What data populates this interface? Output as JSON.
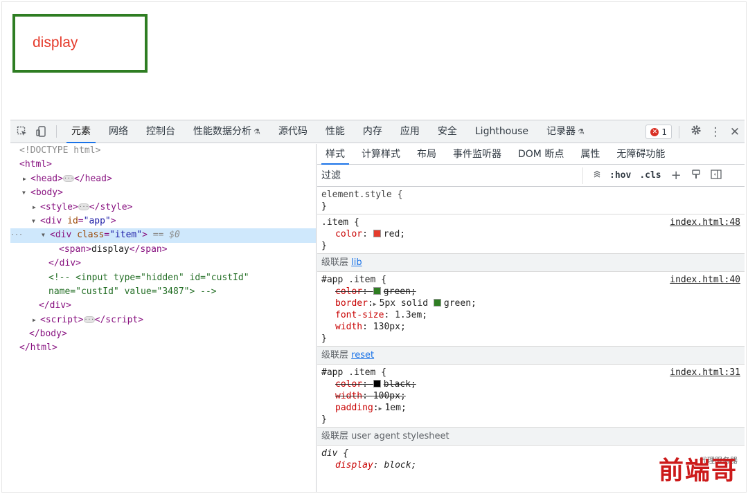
{
  "preview": {
    "text": "display",
    "border_color": "#2e7d22",
    "text_color": "#e53b2c"
  },
  "devtools": {
    "tabs": [
      {
        "label": "元素",
        "active": true
      },
      {
        "label": "网络"
      },
      {
        "label": "控制台"
      },
      {
        "label": "性能数据分析",
        "flask": true
      },
      {
        "label": "源代码"
      },
      {
        "label": "性能"
      },
      {
        "label": "内存"
      },
      {
        "label": "应用"
      },
      {
        "label": "安全"
      },
      {
        "label": "Lighthouse"
      },
      {
        "label": "记录器",
        "flask": true
      }
    ],
    "error_count": "1",
    "icons": [
      "inspect-icon",
      "device-toggle-icon",
      "flask-icon",
      "error-icon",
      "gear-icon",
      "more-icon",
      "close-icon"
    ]
  },
  "elements": {
    "lines": [
      {
        "indent": 0,
        "html": "doc",
        "text": "<!DOCTYPE html>"
      },
      {
        "indent": 0,
        "open": "html"
      },
      {
        "indent": 1,
        "tri": "right",
        "collapsed": "head"
      },
      {
        "indent": 1,
        "tri": "down",
        "open": "body"
      },
      {
        "indent": 2,
        "tri": "right",
        "collapsed": "style"
      },
      {
        "indent": 2,
        "tri": "down",
        "div_app": true
      },
      {
        "indent": 3,
        "tri": "down",
        "div_item": true,
        "selected": true
      },
      {
        "indent": 4,
        "span": true
      },
      {
        "indent": 3,
        "close": "div"
      },
      {
        "indent": 3,
        "comment1": true
      },
      {
        "indent": 3,
        "comment2": true
      },
      {
        "indent": 2,
        "close": "div"
      },
      {
        "indent": 2,
        "tri": "right",
        "collapsed": "script"
      },
      {
        "indent": 1,
        "close": "body"
      },
      {
        "indent": 0,
        "close": "html"
      }
    ],
    "strings": {
      "doctype": "<!DOCTYPE html>",
      "html": "html",
      "head": "head",
      "body": "body",
      "style": "style",
      "div": "div",
      "script": "script",
      "span": "span",
      "id_attr": "id",
      "app": "\"app\"",
      "class_attr": "class",
      "item": "\"item\"",
      "eq_ref": "== $0",
      "span_text": "display",
      "comment_line1": "<!-- <input type=\"hidden\" id=\"custId\"",
      "comment_line2": "name=\"custId\" value=\"3487\"> -->"
    }
  },
  "styles": {
    "subtabs": [
      "样式",
      "计算样式",
      "布局",
      "事件监听器",
      "DOM 断点",
      "属性",
      "无障碍功能"
    ],
    "filter_placeholder": "过滤",
    "hov": ":hov",
    "cls": ".cls",
    "element_style": "element.style {",
    "close_brace": "}",
    "rule_item": {
      "selector": ".item {",
      "source": "index.html:48",
      "props": [
        {
          "name": "color",
          "value": "red",
          "swatch": "#e53b2c"
        }
      ]
    },
    "layer_lib": {
      "prefix": "级联层",
      "link": "lib"
    },
    "rule_app_item_lib": {
      "selector": "#app .item {",
      "source": "index.html:40",
      "color_name": "color",
      "color_value": "green",
      "color_swatch": "#2e7d22",
      "border_name": "border",
      "border_value_a": "5px solid",
      "border_value_b": "green",
      "fontsize_name": "font-size",
      "fontsize_value": "1.3em",
      "width_name": "width",
      "width_value": "130px"
    },
    "layer_reset": {
      "prefix": "级联层",
      "link": "reset"
    },
    "rule_app_item_reset": {
      "selector": "#app .item {",
      "source": "index.html:31",
      "color_name": "color",
      "color_value": "black",
      "color_swatch": "#000000",
      "width_name": "width",
      "width_value": "100px",
      "padding_name": "padding",
      "padding_value": "1em"
    },
    "layer_ua": {
      "prefix": "级联层",
      "label": "user agent stylesheet"
    },
    "rule_div": {
      "selector": "div {",
      "display_name": "display",
      "display_value": "block"
    }
  },
  "watermark": {
    "text": "前端哥",
    "small": "代理服务器"
  }
}
